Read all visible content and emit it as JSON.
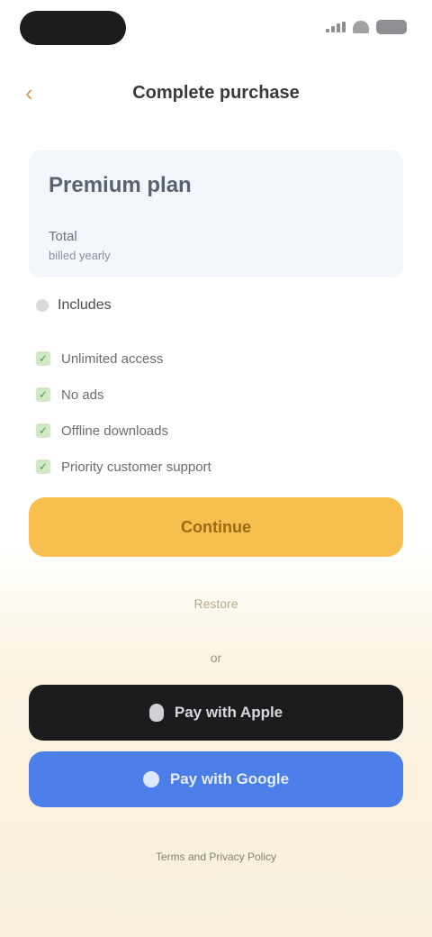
{
  "status_bar": {
    "time": "",
    "icons": [
      "signal-icon",
      "wifi-icon",
      "battery-icon"
    ]
  },
  "header": {
    "back_icon": "chevron-left-icon",
    "title": "Complete purchase"
  },
  "plan": {
    "name": "Premium plan",
    "price": "Total",
    "period": "billed yearly"
  },
  "features": {
    "heading": "Includes",
    "items": [
      "Unlimited access",
      "No ads",
      "Offline downloads",
      "Priority customer support"
    ]
  },
  "actions": {
    "primary_label": "Continue",
    "restore_label": "Restore",
    "or_label": "or",
    "apple_label": "Pay with Apple",
    "google_label": "Pay with Google"
  },
  "footer": {
    "legal": "",
    "terms": "Terms and Privacy Policy"
  },
  "colors": {
    "accent": "#f7c04e",
    "apple": "#1c1c1e",
    "google": "#4b7ee8",
    "background_bottom": "#f8f0dd"
  }
}
